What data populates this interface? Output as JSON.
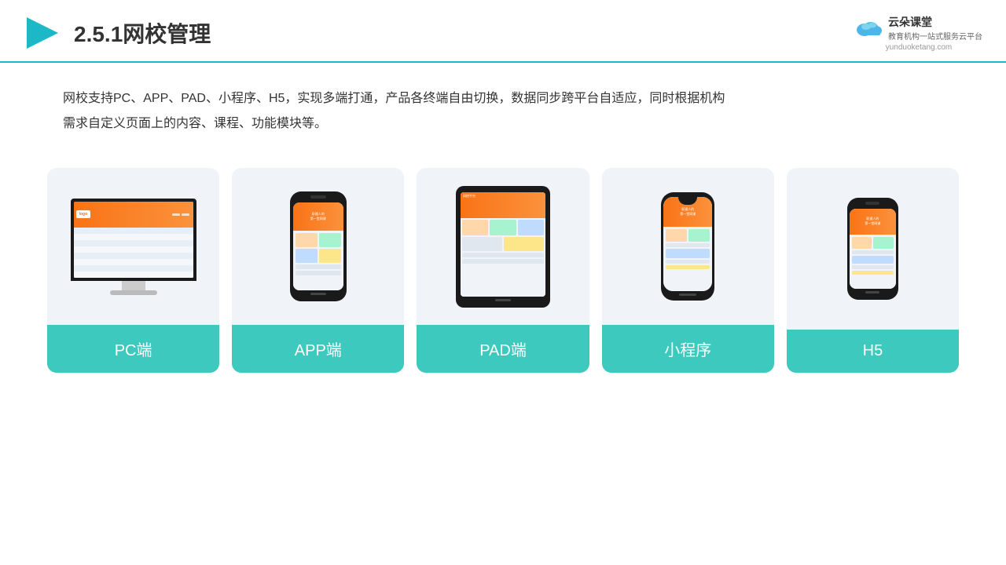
{
  "header": {
    "title": "2.5.1网校管理",
    "logo_main": "云朵课堂",
    "logo_url": "yunduoketang.com",
    "logo_tagline": "教育机构一站式服务云平台"
  },
  "description": {
    "text1": "网校支持PC、APP、PAD、小程序、H5，实现多端打通，产品各终端自由切换，数据同步跨平台自适应，同时根据机构",
    "text2": "需求自定义页面上的内容、课程、功能模块等。"
  },
  "cards": [
    {
      "id": "pc",
      "label": "PC端"
    },
    {
      "id": "app",
      "label": "APP端"
    },
    {
      "id": "pad",
      "label": "PAD端"
    },
    {
      "id": "miniprogram",
      "label": "小程序"
    },
    {
      "id": "h5",
      "label": "H5"
    }
  ],
  "accent_color": "#3dc9be"
}
